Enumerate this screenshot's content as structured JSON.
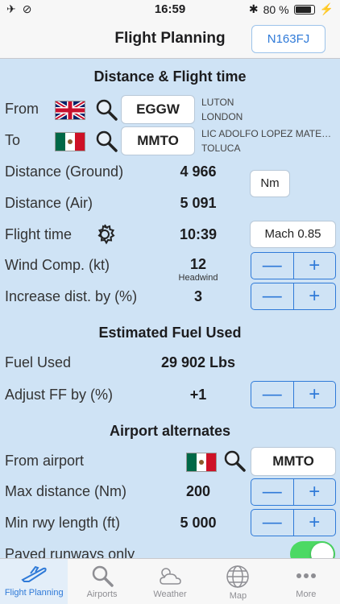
{
  "status": {
    "time": "16:59",
    "battery": "80 %"
  },
  "nav": {
    "title": "Flight Planning",
    "registration": "N163FJ"
  },
  "sections": {
    "distance": "Distance & Flight time",
    "fuel": "Estimated Fuel Used",
    "alternates": "Airport alternates"
  },
  "from": {
    "label": "From",
    "code": "EGGW",
    "name1": "LUTON",
    "name2": "LONDON"
  },
  "to": {
    "label": "To",
    "code": "MMTO",
    "name1": "LIC ADOLFO LOPEZ MATE…",
    "name2": "TOLUCA"
  },
  "rows": {
    "dist_ground": {
      "label": "Distance (Ground)",
      "value": "4 966"
    },
    "dist_air": {
      "label": "Distance (Air)",
      "value": "5 091"
    },
    "unit_button": "Nm",
    "flight_time": {
      "label": "Flight time",
      "value": "10:39"
    },
    "speed_button": "Mach 0.85",
    "wind": {
      "label": "Wind Comp. (kt)",
      "value": "12",
      "sub": "Headwind"
    },
    "increase": {
      "label": "Increase dist. by (%)",
      "value": "3"
    },
    "fuel_used": {
      "label": "Fuel Used",
      "value": "29 902 Lbs"
    },
    "adjust_ff": {
      "label": "Adjust FF by (%)",
      "value": "+1"
    },
    "from_airport": {
      "label": "From airport",
      "code": "MMTO"
    },
    "max_dist": {
      "label": "Max distance (Nm)",
      "value": "200"
    },
    "min_rwy": {
      "label": "Min rwy length (ft)",
      "value": "5 000"
    },
    "paved": {
      "label": "Paved runways only",
      "on": true
    }
  },
  "stepper": {
    "minus": "—",
    "plus": "+"
  },
  "tabs": [
    {
      "label": "Flight Planning",
      "icon": "airplane-icon"
    },
    {
      "label": "Airports",
      "icon": "search-icon"
    },
    {
      "label": "Weather",
      "icon": "weather-icon"
    },
    {
      "label": "Map",
      "icon": "globe-icon"
    },
    {
      "label": "More",
      "icon": "more-icon"
    }
  ]
}
